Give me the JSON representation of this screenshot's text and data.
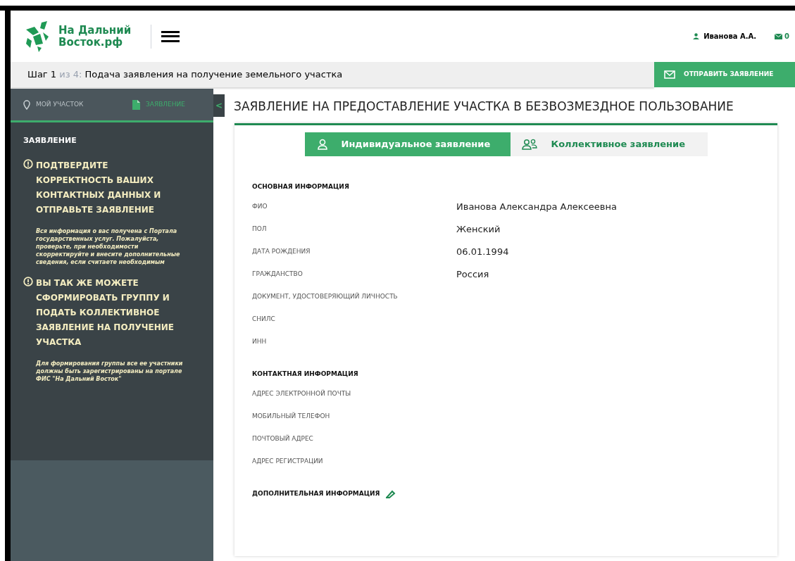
{
  "header": {
    "logo_text": [
      "На Дальний",
      "Восток.рф"
    ],
    "user": "Иванова А.А.",
    "messages": "0"
  },
  "step_bar": {
    "step": "Шаг 1",
    "of": "из 4:",
    "title": "Подача заявления на получение земельного участка",
    "send_button": "ОТПРАВИТЬ ЗАЯВЛЕНИЕ"
  },
  "sidebar": {
    "tabs": [
      {
        "label": "МОЙ УЧАСТОК",
        "kind": "pin",
        "selected": false
      },
      {
        "label": "ЗАЯВЛЕНИЕ",
        "kind": "document",
        "selected": true
      }
    ],
    "collapse": "<",
    "heading": "ЗАЯВЛЕНИЕ",
    "notes": [
      {
        "title": "ПОДТВЕРДИТЕ КОРРЕКТНОСТЬ ВАШИХ КОНТАКТНЫХ ДАННЫХ И ОТПРАВЬТЕ ЗАЯВЛЕНИЕ",
        "text": "Вся информация о вас получена с Портала государственных услуг. Пожалуйста, проверьте, при необходимости скорректируйте и внесите дополнительные сведения, если считаете необходимым"
      },
      {
        "title": "ВЫ ТАК ЖЕ МОЖЕТЕ СФОРМИРОВАТЬ ГРУППУ И ПОДАТЬ КОЛЛЕКТИВНОЕ ЗАЯВЛЕНИЕ НА ПОЛУЧЕНИЕ УЧАСТКА",
        "text": "Для формирования группы все ее участники должны быть зарегистрированы на портале ФИС \"На Дальний Восток\""
      }
    ]
  },
  "page_title": "ЗАЯВЛЕНИЕ НА ПРЕДОСТАВЛЕНИЕ УЧАСТКА В БЕЗВОЗМЕЗДНОЕ ПОЛЬЗОВАНИЕ",
  "application_tabs": [
    {
      "label": "Индивидуальное заявление",
      "kind": "person",
      "selected": true
    },
    {
      "label": "Коллективное заявление",
      "kind": "group",
      "selected": false
    }
  ],
  "sections": [
    {
      "heading": "ОСНОВНАЯ ИНФОРМАЦИЯ",
      "editable": false,
      "fields": [
        {
          "label": "ФИО",
          "value": "Иванова Александра Алексеевна"
        },
        {
          "label": "ПОЛ",
          "value": "Женский"
        },
        {
          "label": "ДАТА РОЖДЕНИЯ",
          "value": "06.01.1994"
        },
        {
          "label": "ГРАЖДАНСТВО",
          "value": "Россия"
        },
        {
          "label": "ДОКУМЕНТ, УДОСТОВЕРЯЮЩИЙ ЛИЧНОСТЬ"
        },
        {
          "label": "СНИЛС"
        },
        {
          "label": "ИНН"
        }
      ]
    },
    {
      "heading": "КОНТАКТНАЯ ИНФОРМАЦИЯ",
      "editable": false,
      "fields": [
        {
          "label": "АДРЕС ЭЛЕКТРОННОЙ ПОЧТЫ"
        },
        {
          "label": "МОБИЛЬНЫЙ ТЕЛЕФОН"
        },
        {
          "label": "ПОЧТОВЫЙ АДРЕС"
        },
        {
          "label": "АДРЕС РЕГИСТРАЦИИ"
        }
      ]
    },
    {
      "heading": "ДОПОЛНИТЕЛЬНАЯ ИНФОРМАЦИЯ",
      "editable": true
    }
  ]
}
